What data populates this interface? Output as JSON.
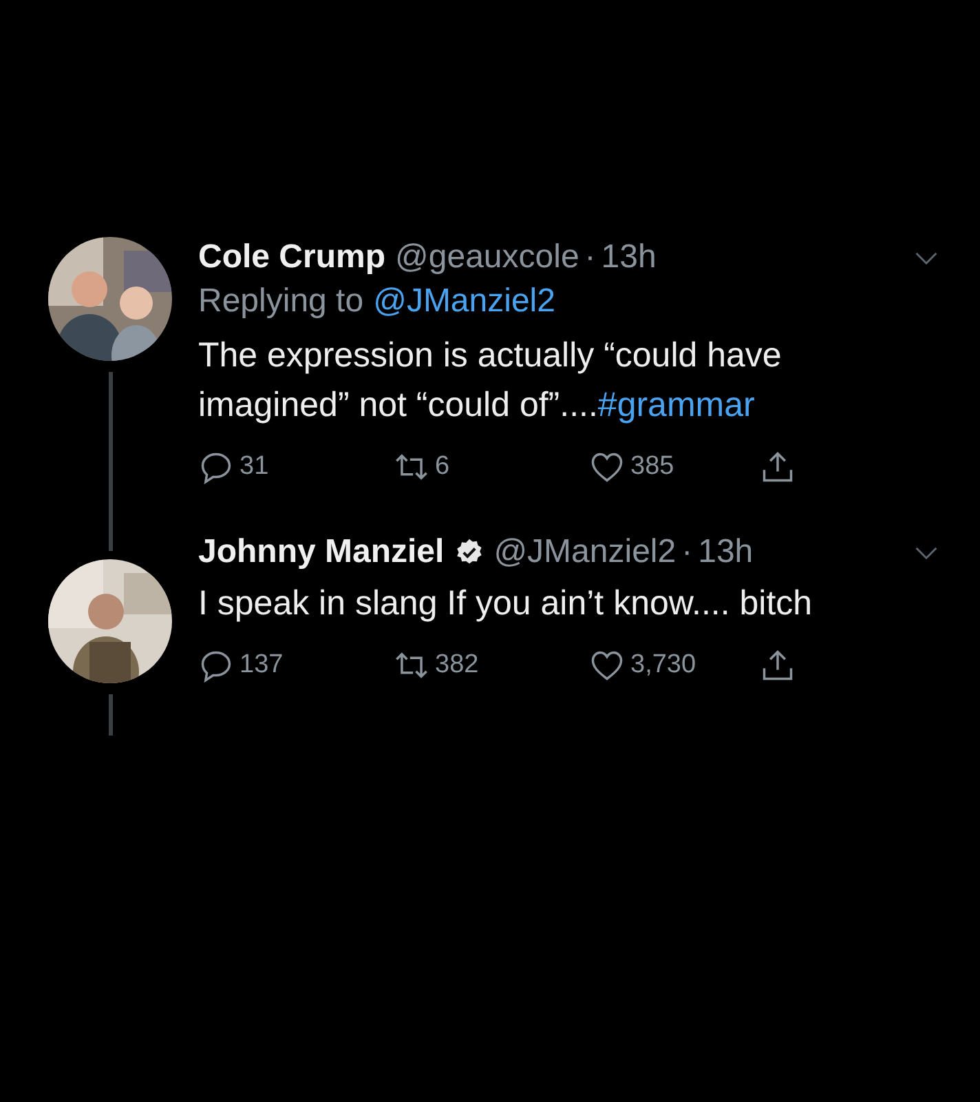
{
  "tweets": [
    {
      "name": "Cole Crump",
      "verified": false,
      "handle": "@geauxcole",
      "separator": "·",
      "time": "13h",
      "replying_to": {
        "prefix": "Replying to",
        "handle": "@JManziel2"
      },
      "body": [
        {
          "kind": "text",
          "text": "The expression is actually “could have imagined” not “could of”...."
        },
        {
          "kind": "link",
          "text": "#grammar"
        }
      ],
      "replies": "31",
      "retweets": "6",
      "likes": "385",
      "thread_above": false
    },
    {
      "name": "Johnny Manziel",
      "verified": true,
      "handle": "@JManziel2",
      "separator": "·",
      "time": "13h",
      "body": [
        {
          "kind": "text",
          "text": "I speak in slang If you ain’t know.... bitch"
        }
      ],
      "replies": "137",
      "retweets": "382",
      "likes": "3,730",
      "thread_above": true
    }
  ]
}
